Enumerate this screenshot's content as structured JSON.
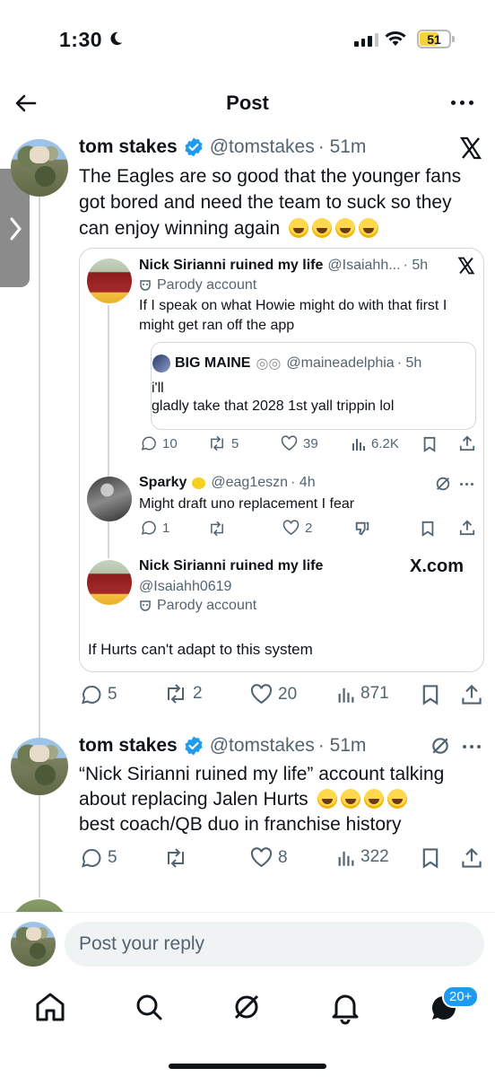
{
  "status_bar": {
    "time": "1:30",
    "battery": "51"
  },
  "header": {
    "title": "Post"
  },
  "main_post": {
    "name": "tom stakes",
    "handle": "@tomstakes",
    "time": "· 51m",
    "text": "The Eagles are so good that the younger fans got bored and need the team to suck so they can enjoy winning again",
    "emoji_count": 4,
    "actions": {
      "replies": "5",
      "reposts": "2",
      "likes": "20",
      "views": "871"
    }
  },
  "quoted_post": {
    "name": "Nick Sirianni ruined my life",
    "handle": "@Isaiahh...",
    "time": "· 5h",
    "parody_label": "Parody account",
    "text": "If I speak on what Howie might do with that first I might get ran off the app",
    "actions": {
      "replies": "10",
      "reposts": "5",
      "likes": "39",
      "views": "6.2K"
    },
    "nested": {
      "name": "BIG MAINE",
      "handle": "@maineadelphia",
      "time": "· 5h",
      "line1": "i'll",
      "line2": "gladly take that 2028 1st yall trippin lol"
    }
  },
  "reply_sparky": {
    "name": "Sparky",
    "handle": "@eag1eszn",
    "time": "· 4h",
    "text": "Might draft uno replacement I fear",
    "actions": {
      "replies": "1",
      "likes": "2"
    }
  },
  "reply_nick": {
    "name": "Nick Sirianni ruined my life",
    "handle": "@Isaiahh0619",
    "parody_label": "Parody account",
    "brand": "X.com",
    "text": "If Hurts can't adapt to this system"
  },
  "second_post": {
    "name": "tom stakes",
    "handle": "@tomstakes",
    "time": "· 51m",
    "line1": "“Nick Sirianni ruined my life” account talking",
    "line2": "about replacing Jalen Hurts",
    "line3": "best coach/QB duo in franchise history",
    "actions": {
      "replies": "5",
      "likes": "8",
      "views": "322"
    }
  },
  "reply_bar": {
    "placeholder": "Post your reply"
  },
  "bottom_nav": {
    "badge": "20+"
  },
  "colors": {
    "accent": "#1d9bf0",
    "verified": "#1d9bf0",
    "text": "#0f1419",
    "muted": "#536471",
    "border": "#cfd9de"
  }
}
